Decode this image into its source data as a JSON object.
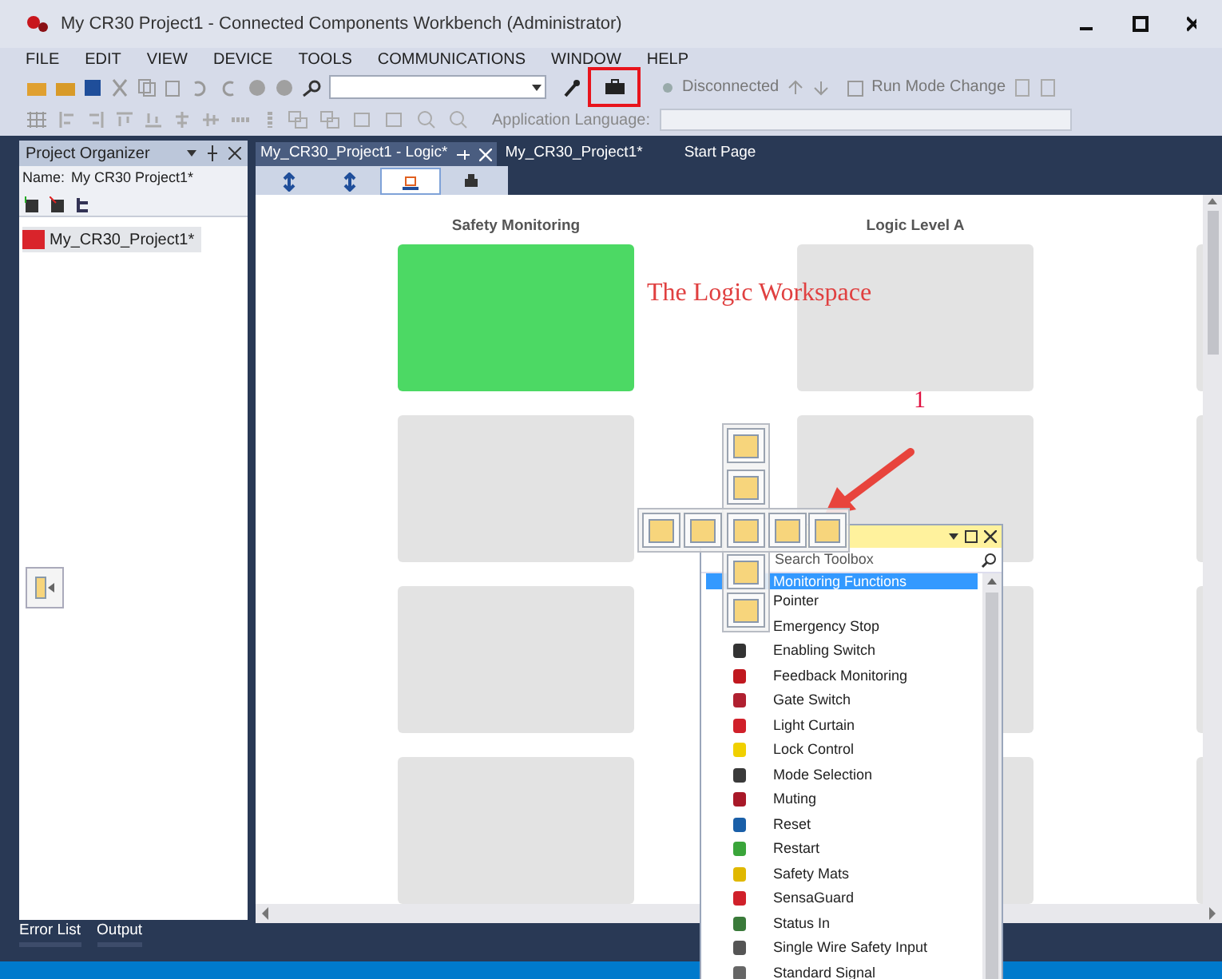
{
  "window": {
    "title": "My CR30 Project1 - Connected Components Workbench (Administrator)"
  },
  "menu": [
    "FILE",
    "EDIT",
    "VIEW",
    "DEVICE",
    "TOOLS",
    "COMMUNICATIONS",
    "WINDOW",
    "HELP"
  ],
  "toolbar": {
    "connection": "Disconnected",
    "run_mode": "Run Mode Change",
    "language_label": "Application Language:"
  },
  "project_organizer": {
    "title": "Project Organizer",
    "name_label": "Name:",
    "name_value": "My CR30 Project1*",
    "items": [
      {
        "label": "My_CR30_Project1*",
        "selected": true
      }
    ]
  },
  "document_tabs": [
    {
      "label": "My_CR30_Project1 - Logic*",
      "selected": true
    },
    {
      "label": "My_CR30_Project1*",
      "selected": false
    },
    {
      "label": "Start Page",
      "selected": false
    }
  ],
  "logic_toolbar": [
    {
      "selected": false
    },
    {
      "selected": false
    },
    {
      "selected": true
    },
    {
      "selected": false
    }
  ],
  "canvas": {
    "columns": [
      {
        "title": "Safety Monitoring",
        "blocks": [
          {
            "kind": "assigned"
          },
          {
            "kind": "empty"
          },
          {
            "kind": "empty"
          },
          {
            "kind": "empty"
          }
        ]
      },
      {
        "title": "Logic Level A",
        "blocks": [
          {
            "kind": "empty"
          },
          {
            "kind": "empty"
          },
          {
            "kind": "empty"
          },
          {
            "kind": "empty"
          }
        ]
      },
      {
        "blocks": [
          {
            "kind": "empty"
          },
          {
            "kind": "empty"
          },
          {
            "kind": "empty"
          },
          {
            "kind": "empty"
          }
        ]
      }
    ]
  },
  "annotations": {
    "caption": "The Logic Workspace",
    "number": "1"
  },
  "toolbox": {
    "search_placeholder": "Search Toolbox",
    "category": "Monitoring Functions",
    "items": [
      {
        "label": "Pointer"
      },
      {
        "label": "Emergency Stop"
      },
      {
        "label": "Enabling Switch",
        "color": "#333333"
      },
      {
        "label": "Feedback Monitoring",
        "color": "#c0181f"
      },
      {
        "label": "Gate Switch",
        "color": "#b02030"
      },
      {
        "label": "Light Curtain",
        "color": "#d0202a"
      },
      {
        "label": "Lock Control",
        "color": "#f0d000"
      },
      {
        "label": "Mode Selection",
        "color": "#3a3a3a"
      },
      {
        "label": "Muting",
        "color": "#a81828"
      },
      {
        "label": "Reset",
        "color": "#1a5fa8"
      },
      {
        "label": "Restart",
        "color": "#3aa53a"
      },
      {
        "label": "Safety Mats",
        "color": "#e0b800"
      },
      {
        "label": "SensaGuard",
        "color": "#d0202a"
      },
      {
        "label": "Status In",
        "color": "#3a7a3a"
      },
      {
        "label": "Single Wire Safety Input",
        "color": "#555555"
      },
      {
        "label": "Standard Signal",
        "color": "#666666"
      }
    ]
  },
  "bottom_tabs": [
    "Error List",
    "Output"
  ]
}
